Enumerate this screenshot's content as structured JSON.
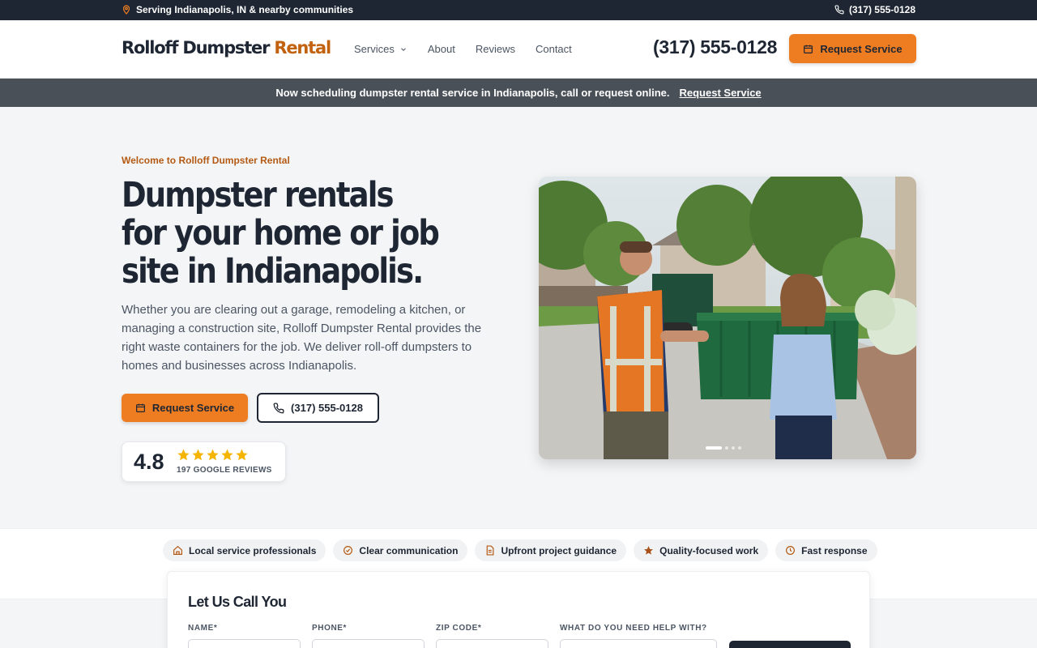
{
  "topbar": {
    "location": "Serving Indianapolis, IN & nearby communities",
    "phone": "(317) 555-0128"
  },
  "header": {
    "logo_main": "Rolloff Dumpster",
    "logo_accent": "Rental",
    "nav": [
      "Services",
      "About",
      "Reviews",
      "Contact"
    ],
    "phone": "(317) 555-0128",
    "cta": "Request Service"
  },
  "announce": {
    "text": "Now scheduling dumpster rental service in Indianapolis, call or request online.",
    "link": "Request Service"
  },
  "hero": {
    "eyebrow": "Welcome to Rolloff Dumpster Rental",
    "title_lines": [
      "Dumpster rentals",
      "for your home or job",
      "site in Indianapolis."
    ],
    "body": "Whether you are clearing out a garage, remodeling a kitchen, or managing a construction site, Rolloff Dumpster Rental provides the right waste containers for the job. We deliver roll-off dumpsters to homes and businesses across Indianapolis.",
    "primary_cta": "Request Service",
    "phone_cta": "(317) 555-0128",
    "rating": "4.8",
    "stars": 5,
    "rating_label": "197 GOOGLE REVIEWS",
    "slides_total": 4,
    "slide_active": 1
  },
  "features": [
    {
      "icon": "home-icon",
      "label": "Local service professionals"
    },
    {
      "icon": "check-circle-icon",
      "label": "Clear communication"
    },
    {
      "icon": "document-icon",
      "label": "Upfront project guidance"
    },
    {
      "icon": "star-icon",
      "label": "Quality-focused work"
    },
    {
      "icon": "clock-icon",
      "label": "Fast response"
    }
  ],
  "form": {
    "title": "Let Us Call You",
    "labels": {
      "name": "NAME*",
      "phone": "PHONE*",
      "zip": "ZIP CODE*",
      "help": "WHAT DO YOU NEED HELP WITH?"
    }
  },
  "colors": {
    "accent": "#ee7d22",
    "dark": "#1e2633",
    "brand_text": "#c2620f"
  }
}
